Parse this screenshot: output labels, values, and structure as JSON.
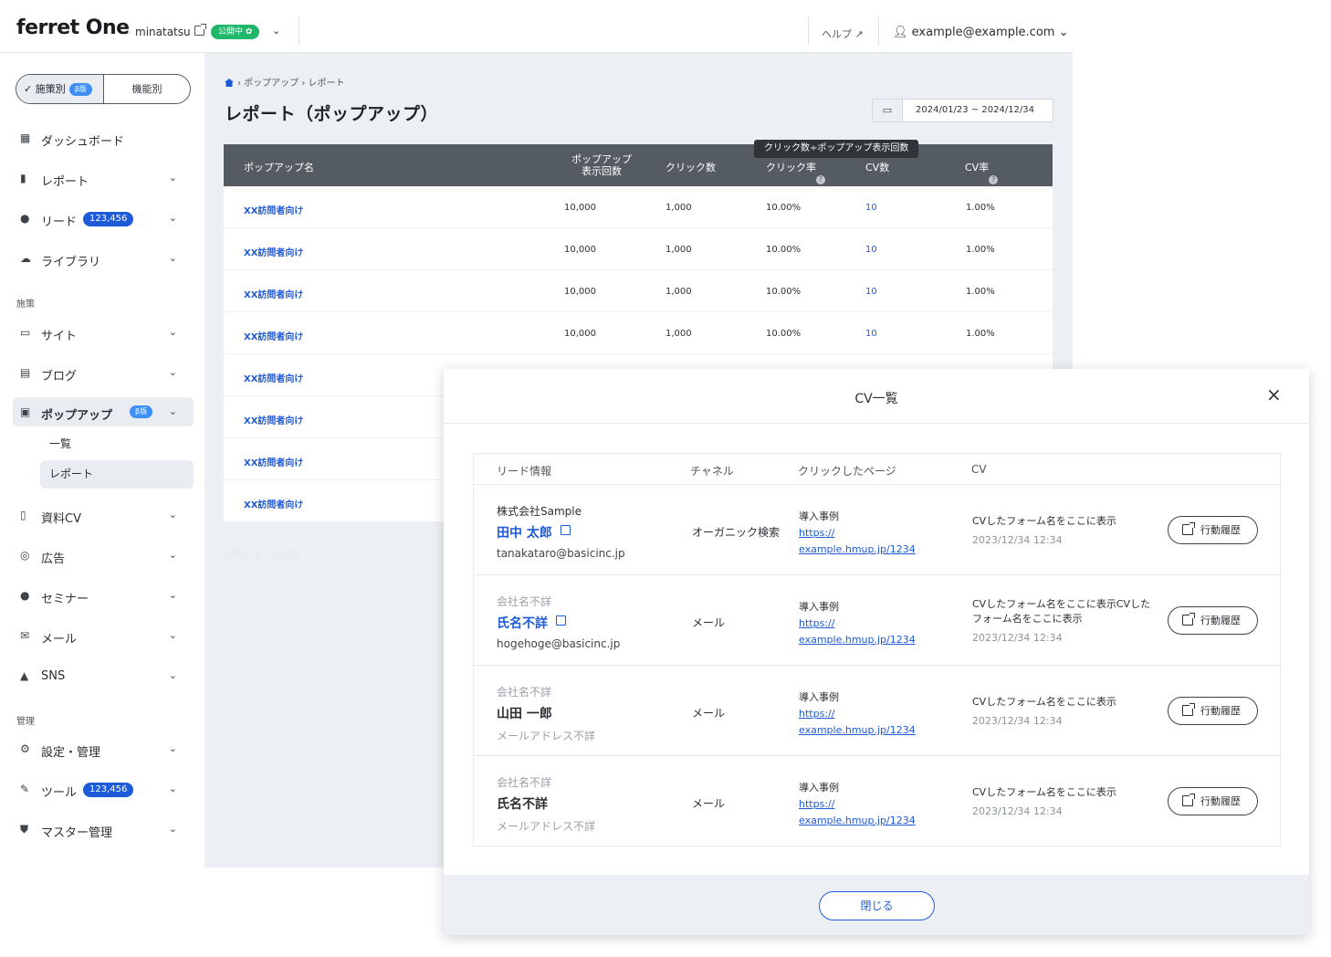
{
  "header": {
    "logo": "ferret One",
    "site_name": "minatatsu",
    "site_status": "公開中 ✿",
    "help": "ヘルプ ↗",
    "user_email": "example@example.com"
  },
  "sidebar": {
    "mode_tabs": [
      {
        "label": "✓ 施策別",
        "badge": "β版"
      },
      {
        "label": "機能別"
      }
    ],
    "items": [
      {
        "label": "ダッシュボード",
        "icon": "grid-icon"
      },
      {
        "label": "レポート",
        "icon": "bar-chart-icon"
      },
      {
        "label": "リード",
        "icon": "people-icon",
        "badge": "123,456"
      },
      {
        "label": "ライブラリ",
        "icon": "cloud-icon"
      },
      {
        "label": "サイト",
        "icon": "window-icon"
      },
      {
        "label": "ブログ",
        "icon": "article-icon"
      },
      {
        "label": "ポップアップ",
        "icon": "popup-icon",
        "badge": "β版"
      },
      {
        "label": "資料CV",
        "icon": "document-icon"
      },
      {
        "label": "広告",
        "icon": "search-ad-icon"
      },
      {
        "label": "セミナー",
        "icon": "seminar-icon"
      },
      {
        "label": "メール",
        "icon": "mail-icon"
      },
      {
        "label": "SNS",
        "icon": "thumbs-up-icon"
      },
      {
        "label": "設定・管理",
        "icon": "gear-icon"
      },
      {
        "label": "ツール",
        "icon": "wrench-icon",
        "badge": "123,456"
      },
      {
        "label": "マスター管理",
        "icon": "shield-icon"
      }
    ],
    "section_measures": "施策",
    "section_admin": "管理",
    "sub_items": [
      "一覧",
      "レポート"
    ]
  },
  "main": {
    "breadcrumb": "› ポップアップ › レポート",
    "title": "レポート（ポップアップ）",
    "date_range": "2024/01/23 ~ 2024/12/34",
    "columns": {
      "name": "ポップアップ名",
      "impressions_line1": "ポップアップ",
      "impressions_line2": "表示回数",
      "clicks": "クリック数",
      "ctr": "クリック率",
      "cv": "CV数",
      "cv_rate": "CV率"
    },
    "tooltip": "クリック数÷ポップアップ表示回数",
    "rows": [
      {
        "name": "XX訪問者向け",
        "impressions": "10,000",
        "clicks": "1,000",
        "ctr": "10.00%",
        "cv": "10",
        "cv_rate": "1.00%"
      },
      {
        "name": "XX訪問者向け",
        "impressions": "10,000",
        "clicks": "1,000",
        "ctr": "10.00%",
        "cv": "10",
        "cv_rate": "1.00%"
      },
      {
        "name": "XX訪問者向け",
        "impressions": "10,000",
        "clicks": "1,000",
        "ctr": "10.00%",
        "cv": "10",
        "cv_rate": "1.00%"
      },
      {
        "name": "XX訪問者向け",
        "impressions": "10,000",
        "clicks": "1,000",
        "ctr": "10.00%",
        "cv": "10",
        "cv_rate": "1.00%"
      },
      {
        "name": "XX訪問者向け"
      },
      {
        "name": "XX訪問者向け"
      },
      {
        "name": "XX訪問者向け"
      },
      {
        "name": "XX訪問者向け"
      }
    ],
    "footnote": "CV数÷クリック数"
  },
  "modal": {
    "title": "CV一覧",
    "close_x": "×",
    "headers": {
      "lead": "リード情報",
      "channel": "チャネル",
      "page": "クリックしたページ",
      "cv": "CV"
    },
    "rows": [
      {
        "company": "株式会社Sample",
        "name": "田中 太郎",
        "email": "tanakataro@basicinc.jp",
        "channel": "オーガニック検索",
        "page_label": "導入事例",
        "page_url": "https://\nexample.hmup.jp/1234",
        "cv_form": "CVしたフォーム名をここに表示",
        "cv_date": "2023/12/34 12:34"
      },
      {
        "company": "会社名不詳",
        "name": "氏名不詳",
        "email": "hogehoge@basicinc.jp",
        "channel": "メール",
        "page_label": "導入事例",
        "page_url": "https://\nexample.hmup.jp/1234",
        "cv_form": "CVしたフォーム名をここに表示CVしたフォーム名をここに表示",
        "cv_date": "2023/12/34 12:34"
      },
      {
        "company": "会社名不詳",
        "name": "山田 一郎",
        "email": "メールアドレス不詳",
        "channel": "メール",
        "page_label": "導入事例",
        "page_url": "https://\nexample.hmup.jp/1234",
        "cv_form": "CVしたフォーム名をここに表示",
        "cv_date": "2023/12/34 12:34"
      },
      {
        "company": "会社名不詳",
        "name": "氏名不詳",
        "email": "メールアドレス不詳",
        "channel": "メール",
        "page_label": "導入事例",
        "page_url": "https://\nexample.hmup.jp/1234",
        "cv_form": "CVしたフォーム名をここに表示",
        "cv_date": "2023/12/34 12:34"
      }
    ],
    "history_button": "行動履歴",
    "close_button": "閉じる"
  },
  "colors": {
    "accent": "#1e5bd8",
    "status_green": "#1fb76a",
    "table_header": "#545b63",
    "main_bg": "#ecf0f4"
  }
}
